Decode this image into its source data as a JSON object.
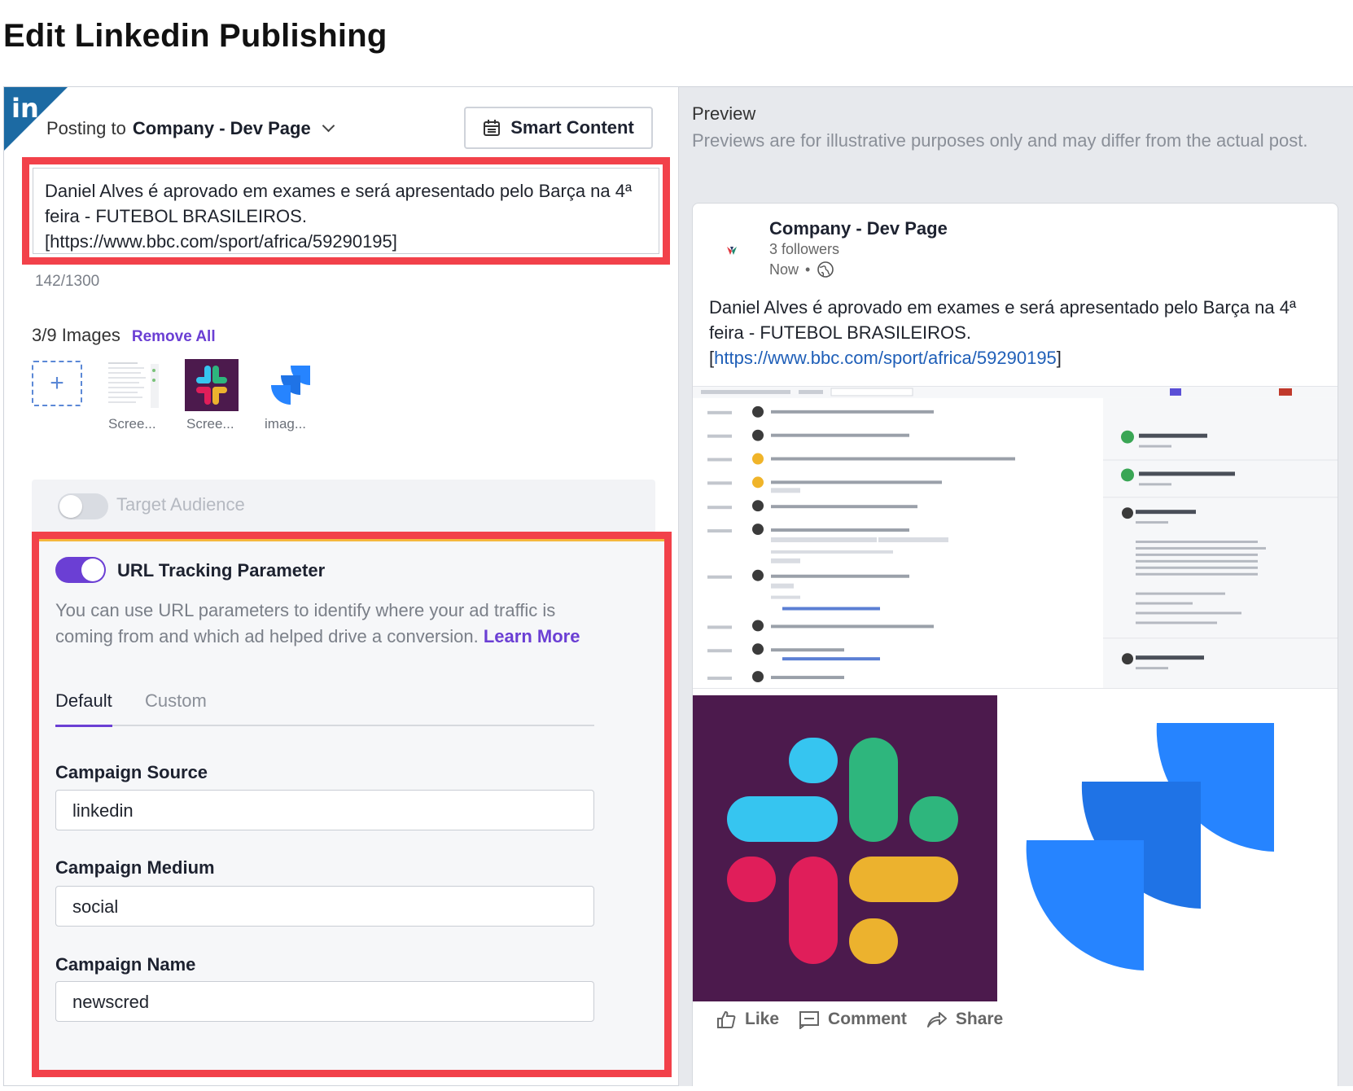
{
  "page": {
    "title": "Edit Linkedin Publishing"
  },
  "left": {
    "platform_badge": "in",
    "posting_label": "Posting to",
    "posting_company": "Company - Dev Page",
    "smart_content_label": "Smart Content",
    "post_text": "Daniel Alves é aprovado em exames e será apresentado pelo Barça na 4ª feira - FUTEBOL BRASILEIROS. [https://www.bbc.com/sport/africa/59290195]",
    "char_count": "142/1300",
    "images_count": "3/9 Images",
    "remove_all_label": "Remove All",
    "add_image_glyph": "+",
    "thumbnails": [
      {
        "label": "Scree...",
        "icon": "screenshot-thumbnail"
      },
      {
        "label": "Scree...",
        "icon": "slack-logo"
      },
      {
        "label": "imag...",
        "icon": "jira-logo"
      }
    ],
    "target_audience": {
      "label": "Target Audience",
      "enabled": false
    },
    "url_tracking": {
      "enabled": true,
      "title": "URL Tracking Parameter",
      "description": "You can use URL parameters to identify where your ad traffic is coming from and which ad helped drive a conversion.",
      "learn_more": "Learn More",
      "tabs": [
        "Default",
        "Custom"
      ],
      "active_tab": "Default",
      "fields": [
        {
          "label": "Campaign Source",
          "value": "linkedin"
        },
        {
          "label": "Campaign Medium",
          "value": "social"
        },
        {
          "label": "Campaign Name",
          "value": "newscred"
        }
      ]
    }
  },
  "preview": {
    "title": "Preview",
    "note": "Previews are for illustrative purposes only and may differ from the actual post.",
    "card": {
      "company": "Company - Dev Page",
      "followers": "3 followers",
      "time": "Now",
      "time_separator": "•",
      "text_prefix": "Daniel Alves é aprovado em exames e será apresentado pelo Barça na 4ª feira - FUTEBOL BRASILEIROS. [",
      "text_link": "https://www.bbc.com/sport/africa/59290195",
      "text_suffix": "]",
      "actions": [
        "Like",
        "Comment",
        "Share"
      ]
    }
  },
  "colors": {
    "accent": "#6b3fd4",
    "highlight": "#f2414a",
    "linkedin": "#1c6aa3"
  }
}
